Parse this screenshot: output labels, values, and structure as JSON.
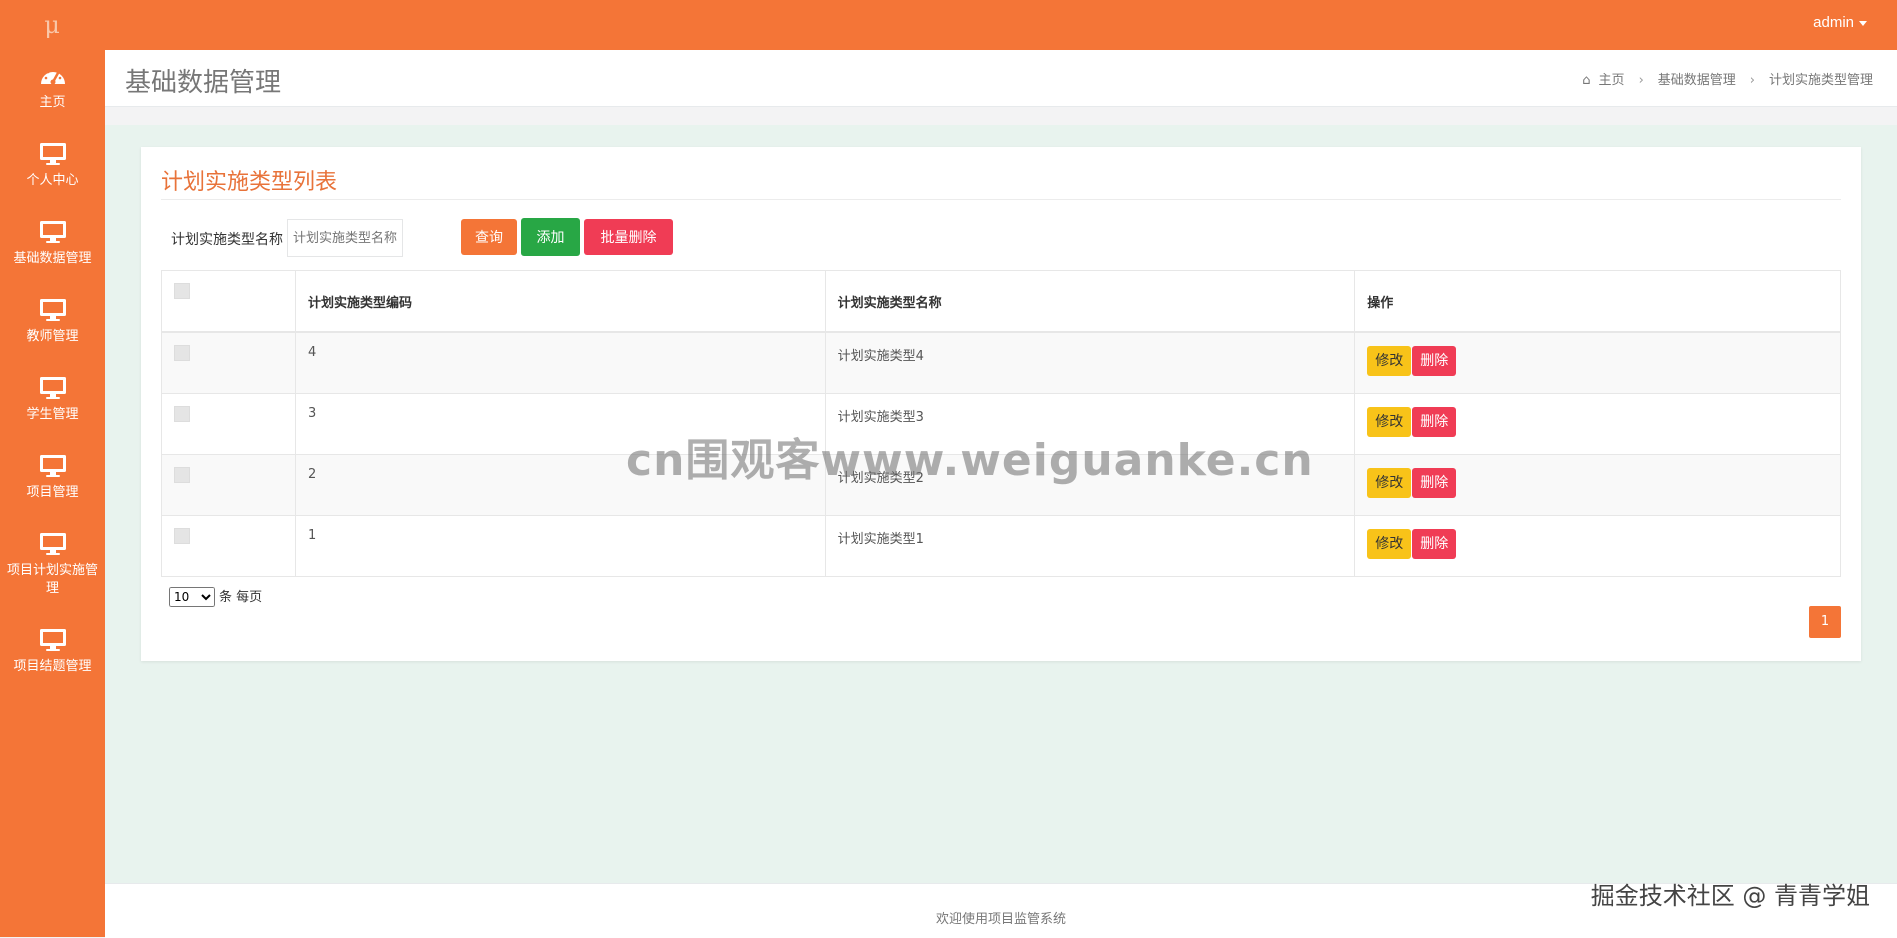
{
  "header": {
    "logo_text": "μ",
    "user": "admin"
  },
  "sidebar": {
    "items": [
      {
        "label": "主页",
        "icon": "dashboard-icon"
      },
      {
        "label": "个人中心",
        "icon": "monitor-icon"
      },
      {
        "label": "基础数据管理",
        "icon": "monitor-icon"
      },
      {
        "label": "教师管理",
        "icon": "monitor-icon"
      },
      {
        "label": "学生管理",
        "icon": "monitor-icon"
      },
      {
        "label": "项目管理",
        "icon": "monitor-icon"
      },
      {
        "label": "项目计划实施管理",
        "icon": "monitor-icon"
      },
      {
        "label": "项目结题管理",
        "icon": "monitor-icon"
      }
    ]
  },
  "page": {
    "title": "基础数据管理",
    "breadcrumb": [
      "主页",
      "基础数据管理",
      "计划实施类型管理"
    ]
  },
  "card": {
    "title": "计划实施类型列表",
    "search_label": "计划实施类型名称",
    "search_placeholder": "计划实施类型名称",
    "buttons": {
      "query": "查询",
      "add": "添加",
      "batch_delete": "批量删除"
    }
  },
  "table": {
    "headers": [
      "计划实施类型编码",
      "计划实施类型名称",
      "操作"
    ],
    "rows": [
      {
        "code": "4",
        "name": "计划实施类型4"
      },
      {
        "code": "3",
        "name": "计划实施类型3"
      },
      {
        "code": "2",
        "name": "计划实施类型2"
      },
      {
        "code": "1",
        "name": "计划实施类型1"
      }
    ],
    "edit_label": "修改",
    "delete_label": "删除"
  },
  "pagination": {
    "page_size": "10",
    "page_size_suffix": "条 每页",
    "current_page": "1"
  },
  "footer": {
    "text": "欢迎使用项目监管系统"
  },
  "watermark": "cn围观客www.weiguanke.cn",
  "credit": "掘金技术社区 @ 青青学姐",
  "colors": {
    "accent": "#f47537",
    "success": "#28a745",
    "danger": "#f03c55",
    "warning": "#f8c319"
  }
}
